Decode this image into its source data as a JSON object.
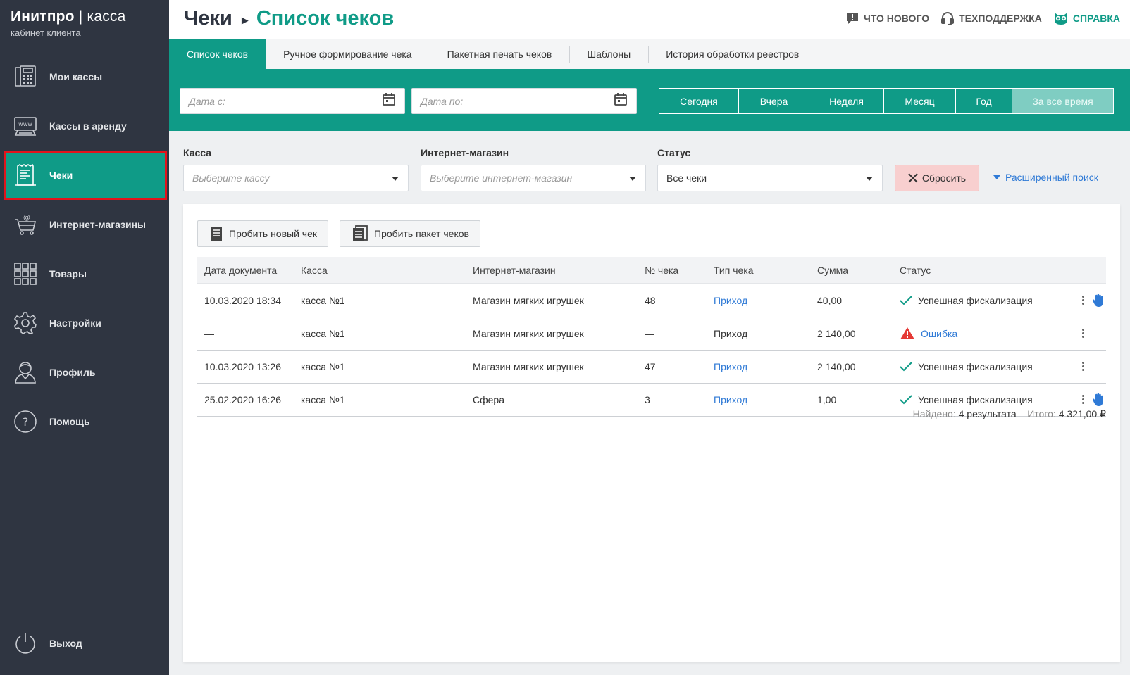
{
  "brand": {
    "name": "Инитпро",
    "separator": "|",
    "product": "касса",
    "subtitle": "кабинет клиента"
  },
  "sidebar": {
    "items": [
      {
        "label": "Мои кассы",
        "icon": "cash-register-icon"
      },
      {
        "label": "Кассы в аренду",
        "icon": "www-terminal-icon"
      },
      {
        "label": "Чеки",
        "icon": "receipt-icon",
        "active": true
      },
      {
        "label": "Интернет-магазины",
        "icon": "shopping-cart-icon"
      },
      {
        "label": "Товары",
        "icon": "grid-icon"
      },
      {
        "label": "Настройки",
        "icon": "gear-icon"
      },
      {
        "label": "Профиль",
        "icon": "user-icon"
      },
      {
        "label": "Помощь",
        "icon": "question-icon"
      }
    ],
    "logout": "Выход"
  },
  "header": {
    "breadcrumb_parent": "Чеки",
    "breadcrumb_current": "Список чеков",
    "links": {
      "whats_new": "Что нового",
      "support": "Техподдержка",
      "help": "Справка"
    }
  },
  "tabs": [
    {
      "label": "Список чеков",
      "active": true
    },
    {
      "label": "Ручное формирование чека"
    },
    {
      "label": "Пакетная печать чеков"
    },
    {
      "label": "Шаблоны"
    },
    {
      "label": "История обработки реестров"
    }
  ],
  "dates": {
    "from_placeholder": "Дата с:",
    "to_placeholder": "Дата по:",
    "periods": [
      "Сегодня",
      "Вчера",
      "Неделя",
      "Месяц",
      "Год",
      "За все время"
    ],
    "active_period": "За все время"
  },
  "filters": {
    "kassa": {
      "label": "Касса",
      "placeholder": "Выберите кассу"
    },
    "shop": {
      "label": "Интернет-магазин",
      "placeholder": "Выберите интернет-магазин"
    },
    "status": {
      "label": "Статус",
      "value": "Все чеки"
    },
    "reset": "Сбросить",
    "advanced": "Расширенный поиск"
  },
  "actions": {
    "new_receipt": "Пробить новый чек",
    "batch": "Пробить пакет чеков"
  },
  "table": {
    "columns": [
      "Дата документа",
      "Касса",
      "Интернет-магазин",
      "№ чека",
      "Тип чека",
      "Сумма",
      "Статус"
    ],
    "rows": [
      {
        "date": "10.03.2020 18:34",
        "kassa": "касса №1",
        "shop": "Магазин мягких игрушек",
        "number": "48",
        "type": "Приход",
        "type_link": true,
        "sum": "40,00",
        "status": "Успешная фискализация",
        "status_kind": "ok",
        "hand": true
      },
      {
        "date": "—",
        "kassa": "касса №1",
        "shop": "Магазин мягких игрушек",
        "number": "—",
        "type": "Приход",
        "type_link": false,
        "sum": "2 140,00",
        "status": "Ошибка",
        "status_kind": "error",
        "hand": false
      },
      {
        "date": "10.03.2020 13:26",
        "kassa": "касса №1",
        "shop": "Магазин мягких игрушек",
        "number": "47",
        "type": "Приход",
        "type_link": true,
        "sum": "2 140,00",
        "status": "Успешная фискализация",
        "status_kind": "ok",
        "hand": false
      },
      {
        "date": "25.02.2020 16:26",
        "kassa": "касса №1",
        "shop": "Сфера",
        "number": "3",
        "type": "Приход",
        "type_link": true,
        "sum": "1,00",
        "status": "Успешная фискализация",
        "status_kind": "ok",
        "hand": true
      }
    ]
  },
  "summary": {
    "found_label": "Найдено:",
    "found_value": "4 результата",
    "total_label": "Итого:",
    "total_value": "4 321,00 ₽"
  },
  "colors": {
    "accent": "#0f9b87",
    "sidebar": "#2f3541",
    "link": "#2f7ad6",
    "highlight": "#e3131b",
    "error": "#e53935"
  }
}
